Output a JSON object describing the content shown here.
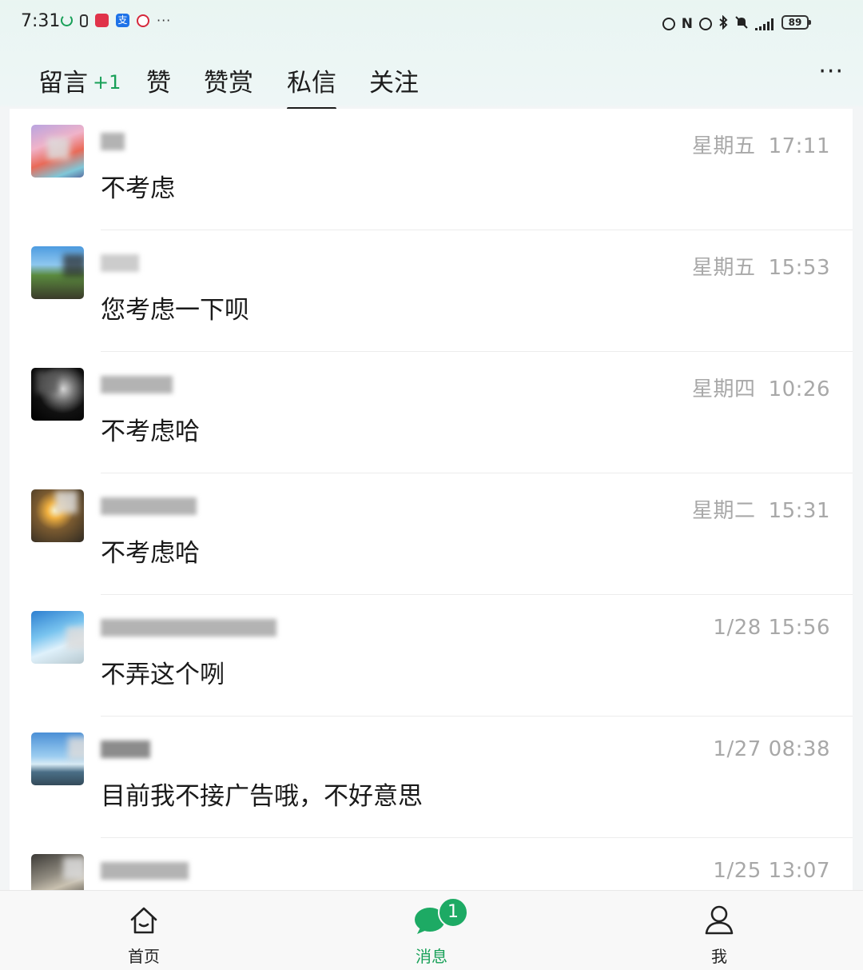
{
  "status_bar": {
    "time": "7:31",
    "left_icons": [
      "recycle-icon",
      "capsule-icon",
      "app-red-icon",
      "alipay-icon",
      "app-circle-icon",
      "more-dots-icon"
    ],
    "left_icon_text_alipay": "支",
    "dots": "···",
    "battery": "89",
    "right_icons": [
      "nfc-alt-icon",
      "nfc-icon",
      "alarm-icon",
      "bluetooth-icon",
      "mute-icon",
      "signal-icon",
      "battery-icon"
    ]
  },
  "tabs": [
    {
      "label": "留言",
      "badge": "+1"
    },
    {
      "label": "赞"
    },
    {
      "label": "赞赏"
    },
    {
      "label": "私信",
      "active": true
    },
    {
      "label": "关注"
    }
  ],
  "more_menu": "···",
  "messages": [
    {
      "weekday": "星期五",
      "time": "17:11",
      "name_tail": "",
      "text": "不考虑",
      "avatar": "avatar-pastel-icon"
    },
    {
      "weekday": "星期五",
      "time": "15:53",
      "name_tail": "",
      "text": "您考虑一下呗",
      "avatar": "avatar-landscape-icon"
    },
    {
      "weekday": "星期四",
      "time": "10:26",
      "name_tail": "",
      "text": "不考虑哈",
      "avatar": "avatar-dark-portrait-icon"
    },
    {
      "weekday": "星期二",
      "time": "15:31",
      "name_tail": "",
      "text": "不考虑哈",
      "avatar": "avatar-firelight-icon"
    },
    {
      "weekday": "",
      "time": "1/28 15:56",
      "name_tail": "",
      "text": "不弄这个咧",
      "avatar": "avatar-sea-icon"
    },
    {
      "weekday": "",
      "time": "1/27 08:38",
      "name_tail": "",
      "text": "目前我不接广告哦，不好意思",
      "avatar": "avatar-lake-icon"
    },
    {
      "weekday": "",
      "time": "1/25 13:07",
      "name_tail": "",
      "text": "",
      "avatar": "avatar-room-icon"
    }
  ],
  "bottom_nav": [
    {
      "label": "首页",
      "icon": "home-icon"
    },
    {
      "label": "消息",
      "icon": "chat-bubble-icon",
      "active": true,
      "badge": "1"
    },
    {
      "label": "我",
      "icon": "person-icon"
    }
  ],
  "colors": {
    "accent": "#18a058",
    "timestamp": "#a8a8a8",
    "text": "#1a1a1a",
    "background": "#f3f5f6"
  }
}
